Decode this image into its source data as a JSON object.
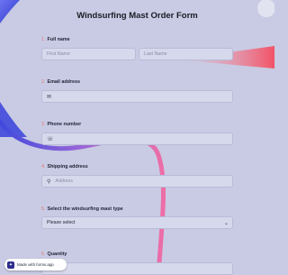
{
  "form": {
    "title": "Windsurfing Mast Order Form",
    "questions": [
      {
        "num": "1.",
        "label": "Full name"
      },
      {
        "num": "2.",
        "label": "Email address"
      },
      {
        "num": "3.",
        "label": "Phone number"
      },
      {
        "num": "4.",
        "label": "Shipping address"
      },
      {
        "num": "5.",
        "label": "Select the windsurfing mast type"
      },
      {
        "num": "6.",
        "label": "Quantity"
      }
    ],
    "fields": {
      "first_name_placeholder": "First Name",
      "last_name_placeholder": "Last Name",
      "address_placeholder": "Address",
      "mast_type_selected": "Please select"
    }
  },
  "badge": {
    "text": "Made with forms.app"
  },
  "icons": {
    "email": "envelope-icon",
    "phone": "phone-icon",
    "address": "location-pin-icon",
    "select": "chevron-down-icon",
    "badge": "forms-app-logo-icon"
  },
  "colors": {
    "background": "#c8cbe3",
    "question_number": "#e77777",
    "field_fill": "#d6d8ec",
    "accent_blue": "#4a55e0",
    "accent_pink": "#ec6fa6",
    "accent_red": "#f05a6a"
  }
}
